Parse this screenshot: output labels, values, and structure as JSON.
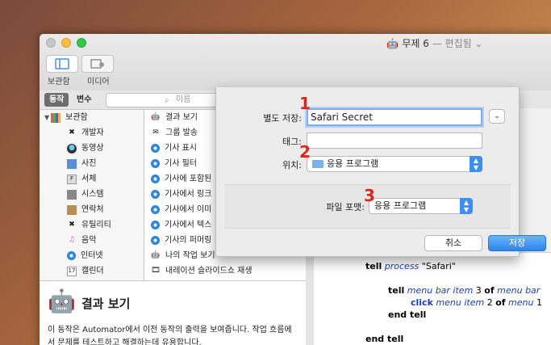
{
  "window": {
    "title": "무제 6",
    "edited": "— 편집됨",
    "edited_chevron": "⌄"
  },
  "toolbar": {
    "library_label": "보관함",
    "media_label": "미디어"
  },
  "filter": {
    "actions_tab": "동작",
    "variables_tab": "변수",
    "search_placeholder": "이름"
  },
  "library": {
    "header": "보관함",
    "items": [
      "개발자",
      "동영상",
      "사진",
      "서체",
      "시스템",
      "연락처",
      "유틸리티",
      "음악",
      "인터넷",
      "캘린더"
    ]
  },
  "actions": {
    "items": [
      "결과 보기",
      "그룹 발송",
      "기사 표시",
      "기사 필터",
      "기사에 포함된",
      "기사에서 링크",
      "기사에서 이미",
      "기사에서 텍스",
      "기사의 퍼머링",
      "나의 작업 보기",
      "내레이션 슬라이드쇼 재생"
    ]
  },
  "description": {
    "title": "결과 보기",
    "body": "이 동작은 Automator에서 이전 동작의 출력을 보여줍니다. 작업 흐름에서 문제를 테스트하고 해결하는데 유용합니다."
  },
  "script": {
    "line1_tell": "tell",
    "line1_process": "process",
    "line1_str": "\"Safari\"",
    "line2_tell": "tell",
    "line2_menubaritem": "menu bar item",
    "line2_num": "3",
    "line2_of": "of",
    "line2_menubar": "menu bar",
    "line3_click": "click",
    "line3_menuitem": "menu item",
    "line3_num": "2",
    "line3_of": "of",
    "line3_menu": "menu",
    "line3_num2": "1",
    "line4_endtell": "end tell",
    "line5_endtell": "end tell"
  },
  "sheet": {
    "save_as_label": "별도 저장:",
    "save_as_value": "Safari Secret",
    "tags_label": "태그:",
    "where_label": "위치:",
    "where_value": "응용 프로그램",
    "format_label": "파일 포맷:",
    "format_value": "응용 프로그램",
    "cancel_label": "취소",
    "save_label": "저장"
  },
  "badges": [
    "1",
    "2",
    "3"
  ],
  "colors": {
    "accent": "#2d84ef",
    "badge": "#e0261c"
  }
}
